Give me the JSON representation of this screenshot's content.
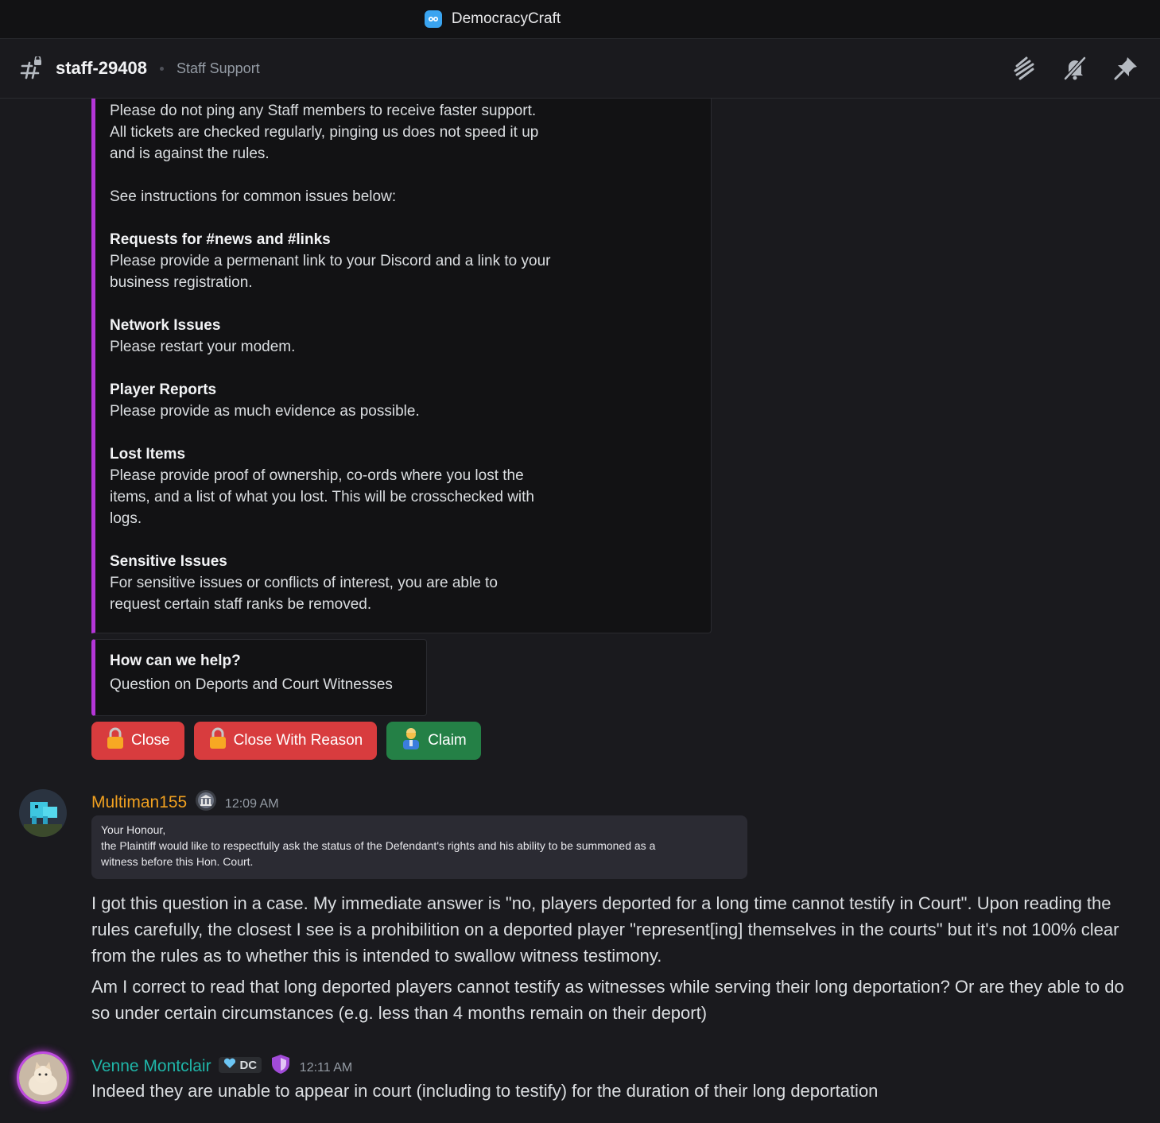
{
  "window": {
    "title": "DemocracyCraft"
  },
  "channel": {
    "name": "staff-29408",
    "topic": "Staff Support"
  },
  "embed": {
    "intro_lines": [
      "Please do not ping any Staff members to receive faster support.",
      "All tickets are checked regularly, pinging us does not speed it up",
      "and is against the rules."
    ],
    "see_instructions": "See instructions for common issues below:",
    "sections": [
      {
        "heading": "Requests for #news and #links",
        "lines": [
          "Please provide a permenant link to your Discord and a link to your",
          "business registration."
        ]
      },
      {
        "heading": "Network Issues",
        "lines": [
          "Please restart your modem."
        ]
      },
      {
        "heading": "Player Reports",
        "lines": [
          "Please provide as much evidence as possible."
        ]
      },
      {
        "heading": "Lost Items",
        "lines": [
          "Please provide proof of ownership, co-ords where you lost the",
          "items, and a list of what you lost. This will be crosschecked with",
          "logs."
        ]
      },
      {
        "heading": "Sensitive Issues",
        "lines": [
          "For sensitive issues or conflicts of interest, you are able to",
          "request certain staff ranks be removed."
        ]
      }
    ]
  },
  "help_embed": {
    "question": "How can we help?",
    "answer": "Question on Deports and Court Witnesses"
  },
  "buttons": {
    "close": "Close",
    "close_reason": "Close With Reason",
    "claim": "Claim"
  },
  "messages": [
    {
      "author": "Multiman155",
      "author_color": "#f0a020",
      "time": "12:09 AM",
      "quote_lines": [
        "Your Honour,",
        "the Plaintiff would like to respectfully ask the status of the Defendant's rights and his ability to be summoned as a",
        "witness before this Hon. Court."
      ],
      "paragraphs": [
        "I got this question in a case. My immediate answer is \"no, players deported for a long time cannot testify in Court\". Upon reading the rules carefully, the closest I see is a prohibilition on a deported player \"represent[ing] themselves in the courts\" but it's not 100% clear from the rules as to whether this is intended to swallow witness testimony.",
        "Am I correct to read that long deported players cannot testify as witnesses while serving their long deportation? Or are they able to do so under certain circumstances (e.g. less than 4 months remain on their deport)"
      ]
    },
    {
      "author": "Venne Montclair",
      "author_color": "#1fb5a8",
      "badge": "DC",
      "time": "12:11 AM",
      "paragraphs": [
        "Indeed they are unable to appear in court (including to testify) for the duration of their long deportation"
      ]
    }
  ]
}
